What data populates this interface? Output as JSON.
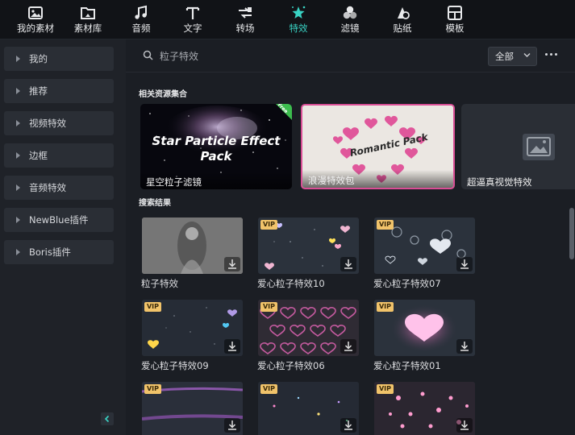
{
  "toolbar": {
    "items": [
      {
        "label": "我的素材",
        "icon": "my-media-icon"
      },
      {
        "label": "素材库",
        "icon": "stock-library-icon"
      },
      {
        "label": "音频",
        "icon": "audio-note-icon"
      },
      {
        "label": "文字",
        "icon": "text-icon"
      },
      {
        "label": "转场",
        "icon": "transition-icon"
      },
      {
        "label": "特效",
        "icon": "effects-star-icon",
        "active": true
      },
      {
        "label": "滤镜",
        "icon": "filters-icon"
      },
      {
        "label": "贴纸",
        "icon": "sticker-icon"
      },
      {
        "label": "模板",
        "icon": "template-icon"
      }
    ],
    "active_color": "#39d3c4"
  },
  "sidebar": {
    "items": [
      {
        "label": "我的"
      },
      {
        "label": "推荐"
      },
      {
        "label": "视频特效"
      },
      {
        "label": "边框"
      },
      {
        "label": "音频特效"
      },
      {
        "label": "NewBlue插件"
      },
      {
        "label": "Boris插件"
      }
    ]
  },
  "search": {
    "placeholder": "粒子特效",
    "filter_value": "全部"
  },
  "related": {
    "title": "相关资源集合",
    "cards": [
      {
        "caption": "星空粒子滤镜",
        "art_text": "Star Particle Effect Pack",
        "badge": "Free"
      },
      {
        "caption": "浪漫特效包",
        "art_text": "Romantic Pack"
      },
      {
        "caption": "超逼真视觉特效"
      }
    ]
  },
  "results": {
    "title": "搜索结果",
    "vip_label": "VIP",
    "items": [
      {
        "caption": "粒子特效",
        "vip": false
      },
      {
        "caption": "爱心粒子特效10",
        "vip": true
      },
      {
        "caption": "爱心粒子特效07",
        "vip": true
      },
      {
        "caption": "爱心粒子特效09",
        "vip": true
      },
      {
        "caption": "爱心粒子特效06",
        "vip": true
      },
      {
        "caption": "爱心粒子特效01",
        "vip": true
      },
      {
        "caption": "",
        "vip": true
      },
      {
        "caption": "",
        "vip": true
      },
      {
        "caption": "",
        "vip": true
      }
    ]
  }
}
